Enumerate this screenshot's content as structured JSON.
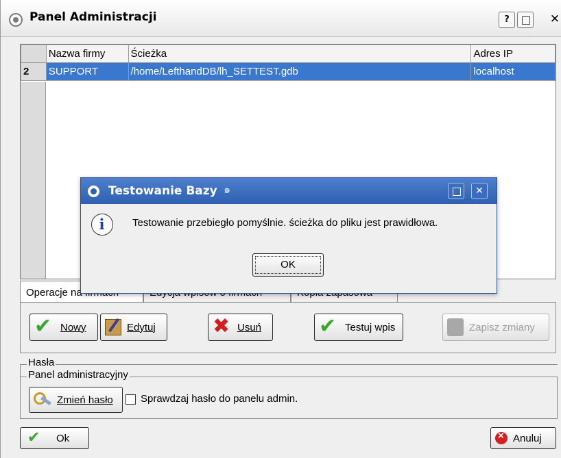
{
  "window": {
    "title": "Panel Administracji",
    "help_label": "?",
    "close_label": "✕"
  },
  "grid": {
    "columns": [
      "",
      "Nazwa firmy",
      "Ścieżka",
      "Adres IP"
    ],
    "rows": [
      {
        "id": "2",
        "name": "SUPPORT",
        "path": "/home/LefthandDB/lh_SETTEST.gdb",
        "ip": "localhost"
      }
    ]
  },
  "tabs": [
    {
      "label": "Operacje na firmach"
    },
    {
      "label": "Edycja wpisów o firmach"
    },
    {
      "label": "Kopia zapasowa"
    }
  ],
  "actions": {
    "new_label": "Nowy",
    "edit_label": "Edytuj",
    "delete_label": "Usuń",
    "test_label": "Testuj wpis",
    "save_label": "Zapisz zmiany"
  },
  "passwords": {
    "group_label": "Hasła",
    "panel_group_label": "Panel administracyjny",
    "change_label": "Zmień hasło",
    "check_label": "Sprawdzaj hasło do panelu admin."
  },
  "footer": {
    "ok_label": "Ok",
    "cancel_label": "Anuluj"
  },
  "dialog": {
    "title": "Testowanie Bazy",
    "close_label": "✕",
    "message": "Testowanie przebiegło pomyślnie. ścieżka do pliku jest prawidłowa.",
    "ok_label": "OK"
  },
  "colors": {
    "selection": "#3a78cf",
    "dialog_title": "#2e5fb0"
  }
}
